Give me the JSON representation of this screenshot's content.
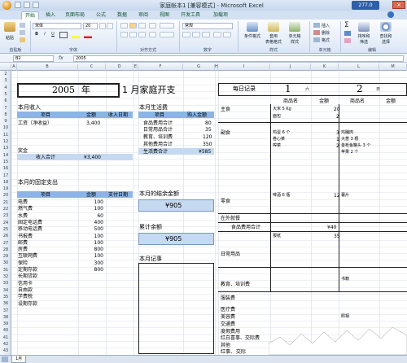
{
  "window": {
    "title": "家庭帐本1 [兼容模式] - Microsoft Excel",
    "watermark": "277.0"
  },
  "tabs": [
    "开始",
    "插入",
    "页面布局",
    "公式",
    "数据",
    "审阅",
    "视图",
    "开发工具",
    "加载项"
  ],
  "ribbon": {
    "paste": "粘贴",
    "font_name": "宋体",
    "font_size": "20",
    "number_format": "常规",
    "cond_format": "条件格式",
    "table_format": "套用\n表格格式",
    "cell_style": "单元格\n样式",
    "insert": "插入",
    "delete": "删除",
    "format": "格式",
    "sort": "排序和\n筛选",
    "find": "查找和\n选择",
    "groups": [
      "剪贴板",
      "字体",
      "对齐方式",
      "数字",
      "样式",
      "单元格",
      "编辑"
    ]
  },
  "formula_bar": {
    "name_box": "B2",
    "fx": "fx",
    "value": "2005"
  },
  "columns": [
    "A",
    "B",
    "C",
    "D",
    "E",
    "F",
    "G",
    "H",
    "I",
    "J",
    "K",
    "L",
    "M"
  ],
  "rows": [
    "2",
    "3",
    "4",
    "5",
    "6",
    "7",
    "8",
    "9",
    "10",
    "11",
    "12",
    "13",
    "14",
    "15",
    "16",
    "17",
    "18",
    "19",
    "20",
    "21",
    "22",
    "23",
    "24",
    "25",
    "26",
    "27",
    "28",
    "29",
    "30",
    "31",
    "32",
    "33",
    "34",
    "35",
    "36",
    "37",
    "38",
    "39",
    "40",
    "41",
    "42",
    "43"
  ],
  "header": {
    "year": "2005",
    "year_suffix": "年",
    "month_title": "1 月家庭开支"
  },
  "income": {
    "title": "本月收入",
    "col_item": "项目",
    "col_amount": "金额",
    "col_date": "收入日期",
    "row1_item": "工资（净收益）",
    "row1_amount": "3,400",
    "bonus": "奖金",
    "total_label": "收入合计",
    "total_value": "¥3,400"
  },
  "living": {
    "title": "本月生活费",
    "col_item": "项目",
    "col_amount": "购入金额",
    "rows": [
      {
        "item": "食品费用合计",
        "amount": "80"
      },
      {
        "item": "日常用品合计",
        "amount": "35"
      },
      {
        "item": "教育、培训费",
        "amount": "120"
      },
      {
        "item": "其他费用合计",
        "amount": "350"
      }
    ],
    "total_label": "生活费合计",
    "total_value": "¥585"
  },
  "fixed": {
    "title": "本月的固定支出",
    "col_item": "项目",
    "col_amount": "金额",
    "col_date": "支付日期",
    "rows": [
      {
        "item": "电费",
        "amount": "100"
      },
      {
        "item": "燃气费",
        "amount": "100"
      },
      {
        "item": "水费",
        "amount": "60"
      },
      {
        "item": "固定电话费",
        "amount": "400"
      },
      {
        "item": "移动电话费",
        "amount": "500"
      },
      {
        "item": "书报费",
        "amount": "100"
      },
      {
        "item": "邮费",
        "amount": "100"
      },
      {
        "item": "房费",
        "amount": "800"
      },
      {
        "item": "互联网费",
        "amount": "100"
      },
      {
        "item": "保险",
        "amount": "300"
      },
      {
        "item": "定期存款",
        "amount": "800"
      },
      {
        "item": "长期贷款",
        "amount": ""
      },
      {
        "item": "信用卡",
        "amount": ""
      },
      {
        "item": "自由款",
        "amount": ""
      },
      {
        "item": "学费税",
        "amount": ""
      },
      {
        "item": "设期存款",
        "amount": ""
      }
    ]
  },
  "balance": {
    "title": "本月的结余金额",
    "value": "¥905"
  },
  "cumulative": {
    "title": "累计余额",
    "value": "¥905"
  },
  "notes": {
    "title": "本月记事"
  },
  "daily": {
    "title": "每日记录",
    "day1": "1",
    "day1_week": "六",
    "day2": "2",
    "day2_week": "日",
    "col_goods": "商品名",
    "col_amount": "金额",
    "col_goods2": "商品名",
    "col_amount2": "金额",
    "cat_staple": "主食",
    "cat_side": "副食",
    "cat_snack": "零食",
    "cat_outside": "在外就餐",
    "food_total_label": "食品费用合计",
    "food_total_value": "¥40",
    "cat_daily": "日常用品",
    "cat_edu": "教育、培训费",
    "cat_misc": "服装费",
    "cat_medical": "医疗费",
    "cat_beauty": "美容费",
    "cat_transport": "交通费",
    "cat_gift": "度假费用",
    "cat_red": "红白喜事、交际费",
    "cat_other": "其他",
    "cat_total": "红事、",
    "cat_last": "交际",
    "items": [
      {
        "name": "大米 5 Kg",
        "amount": "20"
      },
      {
        "name": "面包",
        "amount": "2"
      },
      {
        "name": "鸡蛋 6 个",
        "amount": "3"
      },
      {
        "name": "卷心菜",
        "amount": "1"
      },
      {
        "name": "榨菜",
        "amount": "2"
      },
      {
        "name": "啤酒 6 瓶",
        "amount": "12"
      },
      {
        "name": "报纸",
        "amount": "35"
      }
    ],
    "items2": [
      "鸡脯肉",
      "大葱 3 根",
      "金枪鱼罐头 3 个",
      "苹果 2 个",
      "薯片",
      "书籍",
      "照相"
    ]
  },
  "sheet_tab": "1月"
}
